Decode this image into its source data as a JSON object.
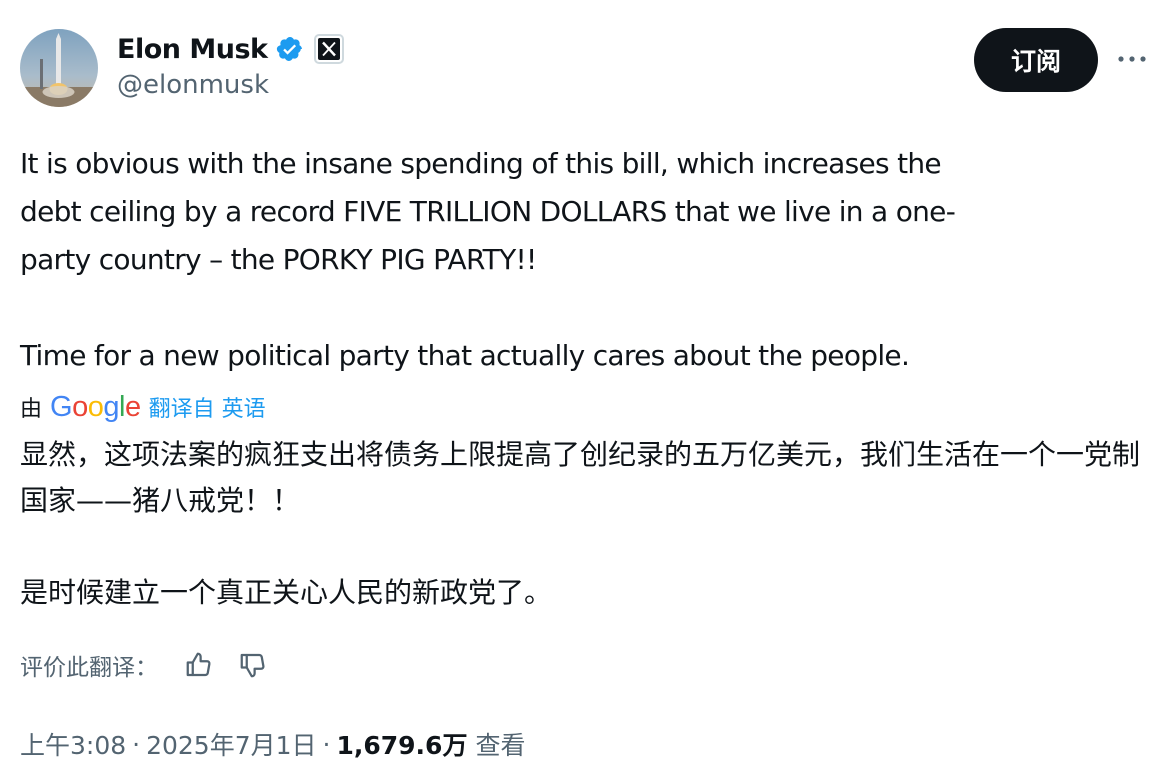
{
  "author": {
    "display_name": "Elon Musk",
    "handle": "@elonmusk",
    "avatar": "rocket-launch-avatar",
    "verified_icon": "verified-badge-icon",
    "affiliate_icon": "x-logo-icon"
  },
  "subscribe_label": "订阅",
  "more_icon": "more-options-icon",
  "tweet": {
    "paragraph1": "It is obvious with the insane spending of this bill, which increases the\ndebt ceiling by a record FIVE TRILLION DOLLARS that we live in a one-\nparty country – the PORKY PIG PARTY!!",
    "paragraph2": "Time for a new political party that actually cares about the people."
  },
  "translation": {
    "by_label": "由",
    "provider": "Google",
    "from_label": "翻译自 英语",
    "paragraph1": "显然，这项法案的疯狂支出将债务上限提高了创纪录的五万亿美元，我们生活在一个一党制国家——猪八戒党！！",
    "paragraph2": "是时候建立一个真正关心人民的新政党了。"
  },
  "rate": {
    "label": "评价此翻译：",
    "thumbs_up_icon": "thumbs-up-icon",
    "thumbs_down_icon": "thumbs-down-icon"
  },
  "meta": {
    "time": "上午3:08",
    "separator": "·",
    "date": "2025年7月1日",
    "views_count": "1,679.6万",
    "views_label": "查看"
  },
  "colors": {
    "text": "#0f1419",
    "secondary": "#536471",
    "link": "#1d9bf0",
    "verified": "#1d9bf0",
    "button_bg": "#0f1419"
  }
}
